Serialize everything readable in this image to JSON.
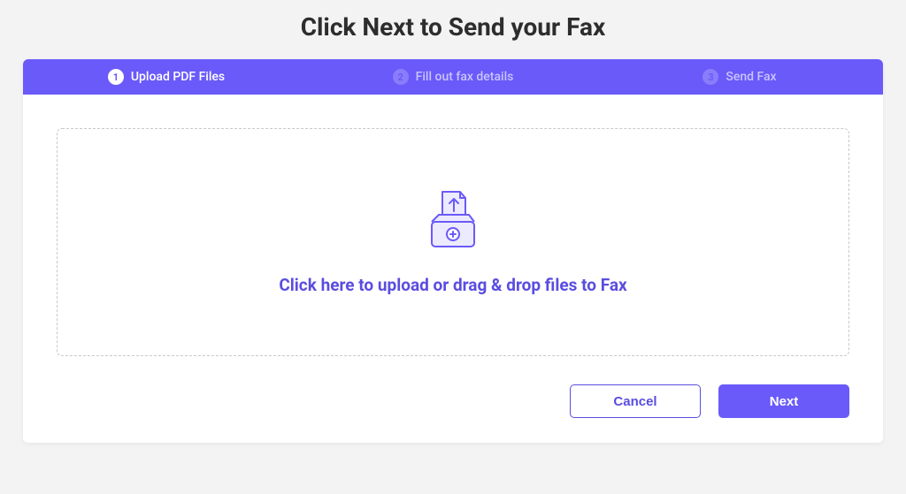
{
  "title": "Click Next to Send your Fax",
  "stepper": {
    "steps": [
      {
        "num": "1",
        "label": "Upload PDF Files",
        "active": true
      },
      {
        "num": "2",
        "label": "Fill out fax details",
        "active": false
      },
      {
        "num": "3",
        "label": "Send Fax",
        "active": false
      }
    ]
  },
  "dropzone": {
    "prompt": "Click here to upload or drag & drop files to Fax"
  },
  "actions": {
    "cancel": "Cancel",
    "next": "Next"
  },
  "colors": {
    "primary": "#6a5af9",
    "primaryText": "#5a4de0"
  }
}
